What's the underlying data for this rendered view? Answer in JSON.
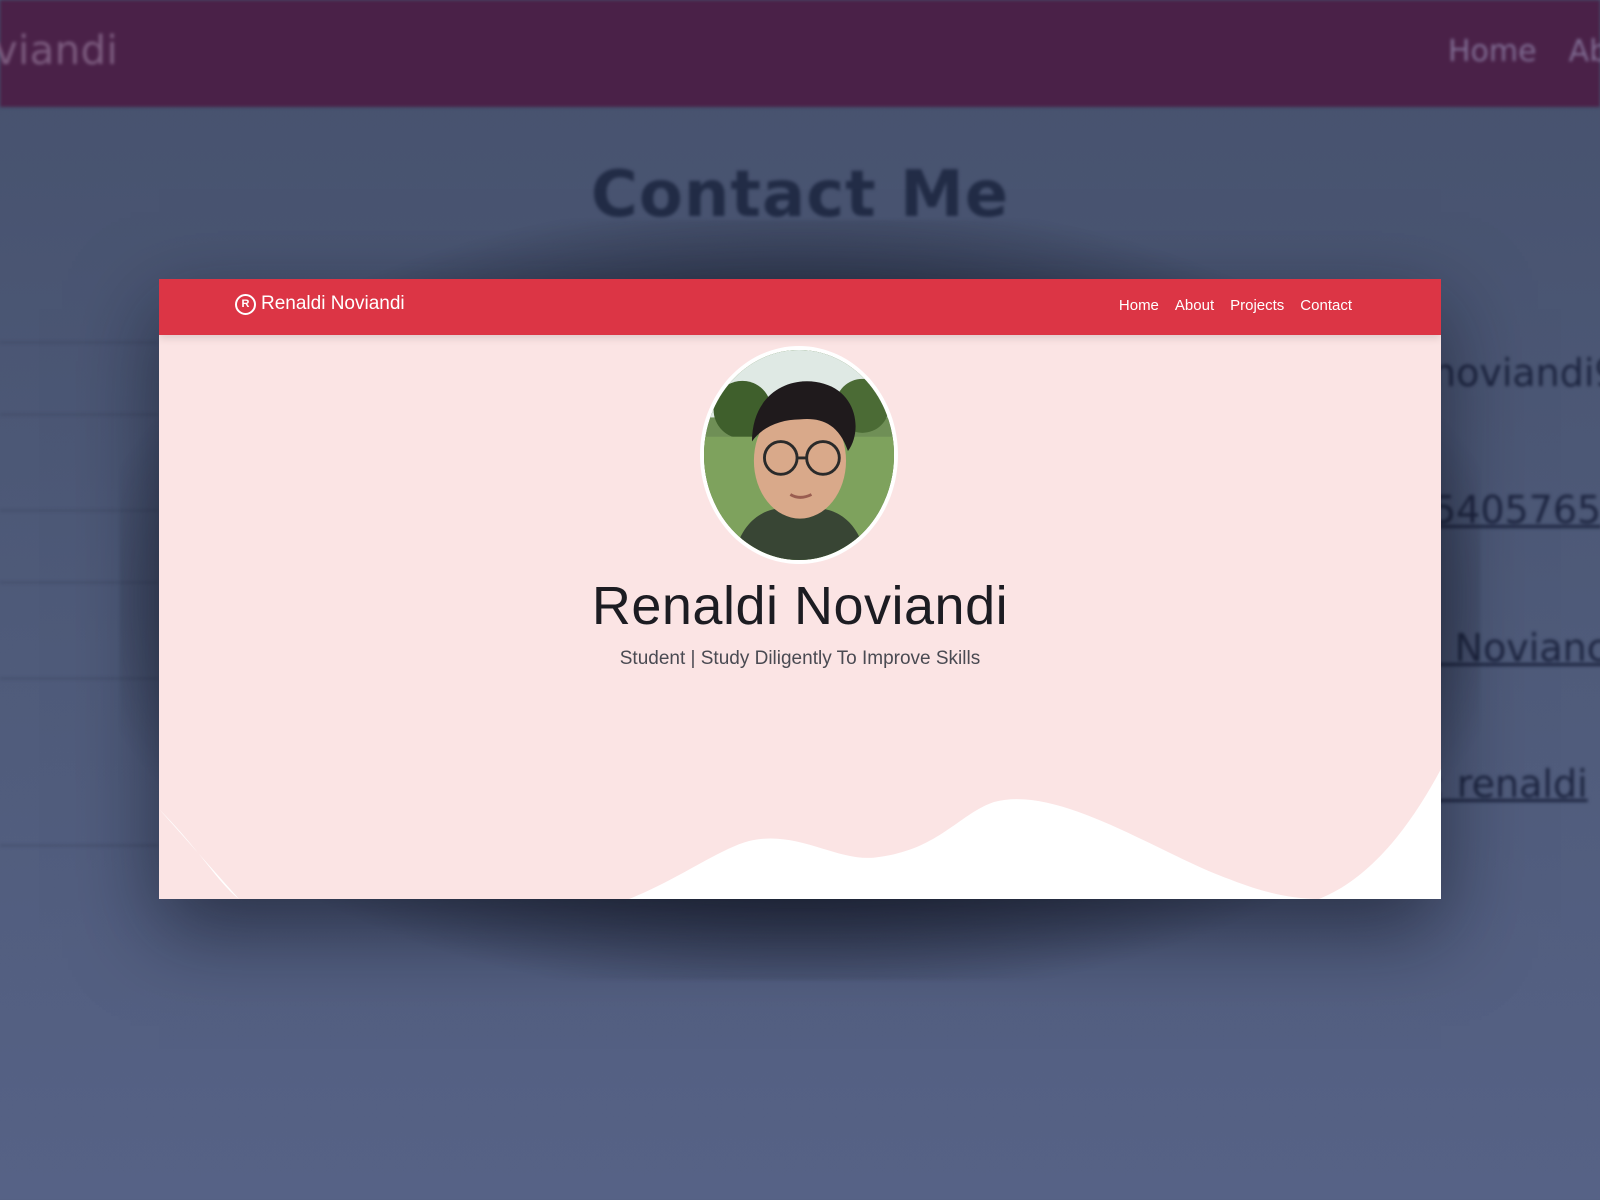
{
  "background_page": {
    "brand_partial": "viandi",
    "nav": [
      "Home",
      "Ab"
    ],
    "title": "Contact Me",
    "contact_fragments": [
      "noviandi9",
      "5405765",
      "i Novianc",
      ": renaldi"
    ]
  },
  "card": {
    "brand": {
      "icon": "r-circle-icon",
      "icon_glyph": "R",
      "name": "Renaldi Noviandi"
    },
    "nav": [
      "Home",
      "About",
      "Projects",
      "Contact"
    ],
    "hero": {
      "name": "Renaldi Noviandi",
      "subtitle": "Student | Study Diligently To Improve Skills"
    }
  },
  "colors": {
    "bg_nav": "#4a2148",
    "card_nav": "#dc3545",
    "card_bg": "#fbe4e4",
    "wave": "#ffffff"
  }
}
